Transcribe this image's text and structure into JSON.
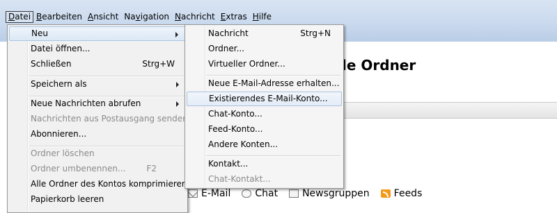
{
  "menubar": {
    "items": [
      {
        "label": "Datei",
        "active": true
      },
      {
        "label": "Bearbeiten"
      },
      {
        "label": "Ansicht"
      },
      {
        "label": "Navigation"
      },
      {
        "label": "Nachricht"
      },
      {
        "label": "Extras"
      },
      {
        "label": "Hilfe"
      }
    ]
  },
  "background": {
    "heading_fragment": "le Ordner",
    "account_links": [
      {
        "label": "E-Mail",
        "icon": "mail-icon"
      },
      {
        "label": "Chat",
        "icon": "chat-icon"
      },
      {
        "label": "Newsgruppen",
        "icon": "newsgroup-icon"
      },
      {
        "label": "Feeds",
        "icon": "feed-icon"
      }
    ]
  },
  "datei_menu": {
    "items": [
      {
        "label": "Neu",
        "submenu": true
      },
      {
        "label": "Datei öffnen..."
      },
      {
        "label": "Schließen",
        "shortcut": "Strg+W"
      },
      {
        "label": "Speichern als",
        "submenu": true
      },
      {
        "label": "Neue Nachrichten abrufen",
        "submenu": true
      },
      {
        "label": "Nachrichten aus Postausgang senden",
        "disabled": true
      },
      {
        "label": "Abonnieren..."
      },
      {
        "label": "Ordner löschen",
        "disabled": true
      },
      {
        "label": "Ordner umbenennen...",
        "shortcut": "F2",
        "disabled": true
      },
      {
        "label": "Alle Ordner des Kontos komprimieren"
      },
      {
        "label": "Papierkorb leeren"
      }
    ]
  },
  "neu_menu": {
    "items": [
      {
        "label": "Nachricht",
        "shortcut": "Strg+N"
      },
      {
        "label": "Ordner..."
      },
      {
        "label": "Virtueller Ordner..."
      },
      {
        "label": "Neue E-Mail-Adresse erhalten..."
      },
      {
        "label": "Existierendes E-Mail-Konto..."
      },
      {
        "label": "Chat-Konto..."
      },
      {
        "label": "Feed-Konto..."
      },
      {
        "label": "Andere Konten..."
      },
      {
        "label": "Kontakt..."
      },
      {
        "label": "Chat-Kontakt...",
        "disabled": true
      }
    ]
  }
}
